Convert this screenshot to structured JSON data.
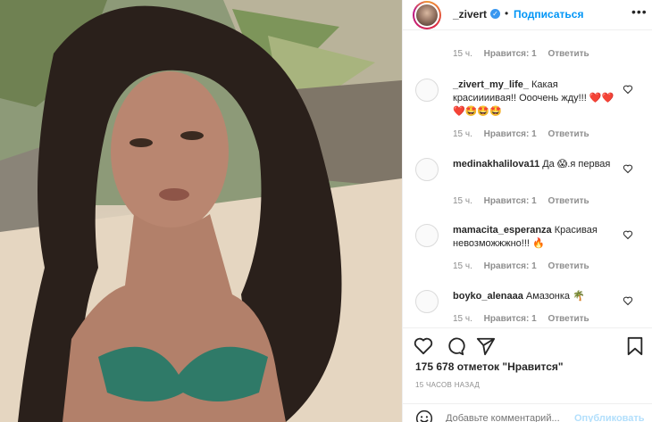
{
  "post": {
    "image_alt": "",
    "author": "_zivert",
    "follow_label": "Подписаться",
    "dot": "•",
    "more_label": "•••"
  },
  "comments": [
    {
      "author": "",
      "text": "",
      "time": "15 ч.",
      "likes": "Нравится: 1",
      "reply": "Ответить"
    },
    {
      "author": "_zivert_my_life_",
      "text": "Какая красиииивая!! Ооочень жду!!! ❤️❤️❤️🤩🤩🤩",
      "time": "15 ч.",
      "likes": "Нравится: 1",
      "reply": "Ответить"
    },
    {
      "author": "medinakhalilova11",
      "text": "Да 😱.я первая",
      "time": "15 ч.",
      "likes": "Нравится: 1",
      "reply": "Ответить"
    },
    {
      "author": "mamacita_esperanza",
      "text": "Красивая невозможжжно!!! 🔥",
      "time": "15 ч.",
      "likes": "Нравится: 1",
      "reply": "Ответить"
    },
    {
      "author": "boyko_alenaaa",
      "text": "Амазонка 🌴",
      "time": "15 ч.",
      "likes": "Нравится: 1",
      "reply": "Ответить"
    }
  ],
  "footer": {
    "likes_text": "175 678 отметок \"Нравится\"",
    "time_ago": "15 ЧАСОВ НАЗАД",
    "add_comment_placeholder": "Добавьте комментарий...",
    "publish_label": "Опубликовать"
  },
  "icons": {
    "like": "heart-icon",
    "comment": "comment-icon",
    "share": "share-icon",
    "save": "bookmark-icon",
    "verified": "verified-badge-icon",
    "emoji": "emoji-icon"
  },
  "colors": {
    "accent": "#0095f6",
    "verified": "#3897f0",
    "muted": "#8e8e8e",
    "publish_disabled": "#b2dffc"
  }
}
